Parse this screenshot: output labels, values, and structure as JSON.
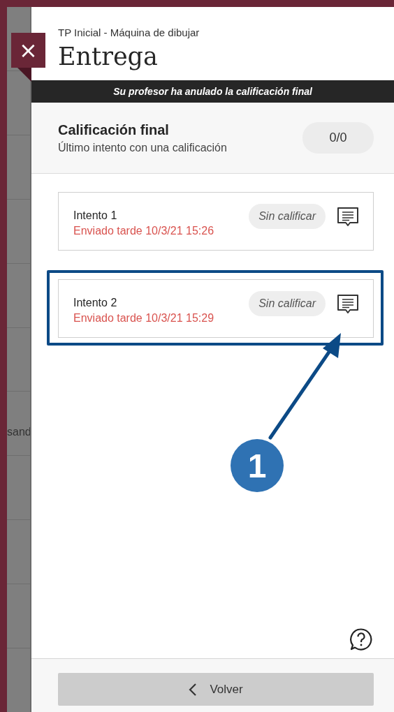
{
  "background_fragment": "sand",
  "header": {
    "close_label": "×",
    "subtitle": "TP Inicial - Máquina de dibujar",
    "title": "Entrega"
  },
  "banner": "Su profesor ha anulado la calificación final",
  "final_grade": {
    "title": "Calificación final",
    "subtitle": "Último intento con una calificación",
    "score": "0/0"
  },
  "attempts": [
    {
      "title": "Intento 1",
      "submitted": "Enviado tarde 10/3/21 15:26",
      "late": true,
      "status": "Sin calificar",
      "highlighted": false
    },
    {
      "title": "Intento 2",
      "submitted": "Enviado tarde 10/3/21 15:29",
      "late": true,
      "status": "Sin calificar",
      "highlighted": true
    }
  ],
  "annotation": {
    "number": "1"
  },
  "footer": {
    "back_button": "Volver"
  }
}
